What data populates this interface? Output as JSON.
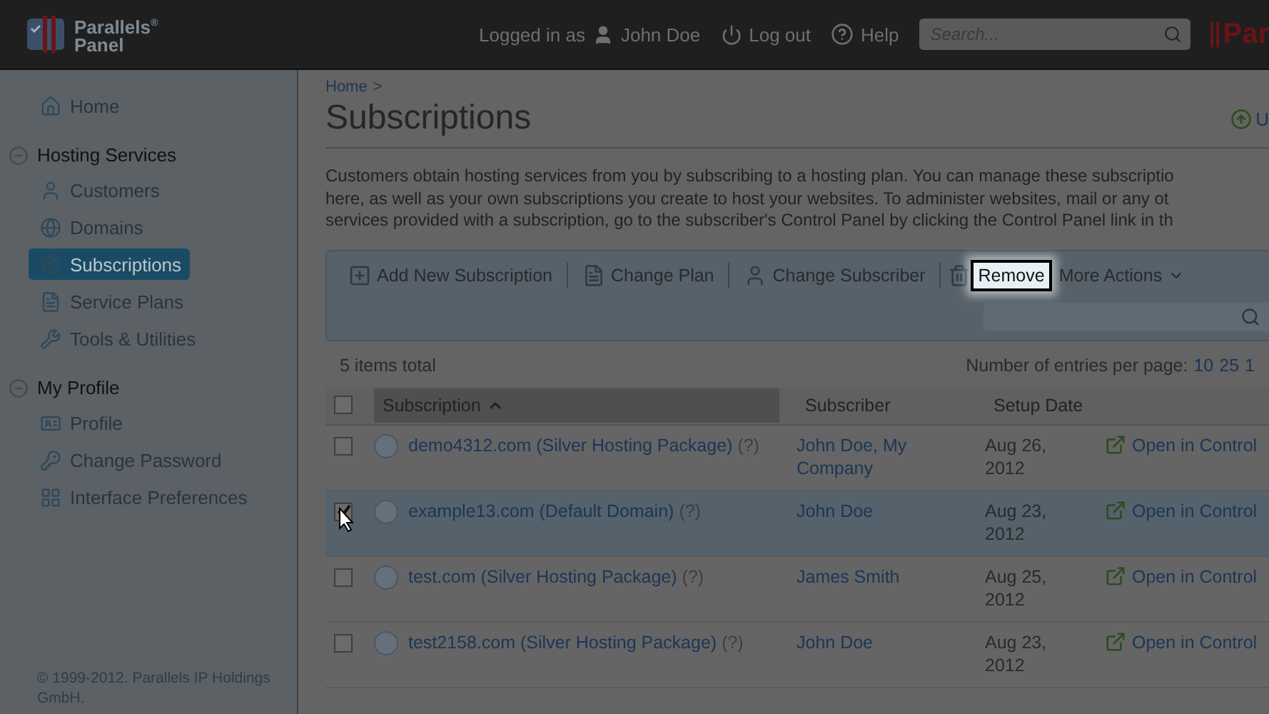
{
  "header": {
    "logo_line1": "Parallels",
    "logo_mark": "®",
    "logo_line2": "Panel",
    "logged_in_label": "Logged in as",
    "user": "John Doe",
    "logout": "Log out",
    "help": "Help",
    "search": {
      "placeholder": "Search..."
    },
    "brand_fragment": "Par"
  },
  "sidebar": {
    "items": [
      {
        "kind": "link",
        "label": "Home",
        "selected": false
      },
      {
        "kind": "section",
        "label": "Hosting Services",
        "expanded": true,
        "children": [
          {
            "label": "Customers",
            "selected": false
          },
          {
            "label": "Domains",
            "selected": false
          },
          {
            "label": "Subscriptions",
            "selected": true
          },
          {
            "label": "Service Plans",
            "selected": false
          },
          {
            "label": "Tools & Utilities",
            "selected": false
          }
        ]
      },
      {
        "kind": "section",
        "label": "My Profile",
        "expanded": true,
        "children": [
          {
            "label": "Profile",
            "selected": false
          },
          {
            "label": "Change Password",
            "selected": false
          },
          {
            "label": "Interface Preferences",
            "selected": false
          }
        ]
      }
    ],
    "footer": "© 1999-2012. Parallels IP Holdings GmbH."
  },
  "breadcrumb": {
    "items": [
      "Home"
    ],
    "separator": ">"
  },
  "title": "Subscriptions",
  "title_action": "U",
  "description": [
    "Customers obtain hosting services from you by subscribing to a hosting plan. You can manage these subscriptio",
    "here, as well as your own subscriptions you create to host your websites. To administer websites, mail or any ot",
    "services provided with a subscription, go to the subscriber's Control Panel by clicking the Control Panel link in th"
  ],
  "toolbar": [
    {
      "kind": "button",
      "label": "Add New Subscription",
      "highlighted": false
    },
    {
      "kind": "button",
      "label": "Change Plan",
      "highlighted": false
    },
    {
      "kind": "button",
      "label": "Change Subscriber",
      "highlighted": false
    },
    {
      "kind": "button",
      "label": "Remove",
      "highlighted": true
    },
    {
      "kind": "menu",
      "label": "More Actions",
      "highlighted": false
    }
  ],
  "items_total": "5 items total",
  "per_page_label": "Number of entries per page:",
  "per_page_options": [
    "10",
    "25",
    "1"
  ],
  "table": {
    "columns": [
      {
        "label": "Subscription",
        "sorted": true
      },
      {
        "label": "Subscriber",
        "sorted": false
      },
      {
        "label": "Setup Date",
        "sorted": false
      }
    ],
    "select_all": false,
    "rows": [
      {
        "subscription": "demo4312.com (Silver Hosting Package)",
        "hint": "(?)",
        "subscriber": "John Doe, My Company",
        "date": "Aug 26, 2012",
        "action": "Open in Control",
        "checked": false
      },
      {
        "subscription": "example13.com (Default Domain)",
        "hint": "(?)",
        "subscriber": "John Doe",
        "date": "Aug 23, 2012",
        "action": "Open in Control",
        "checked": true
      },
      {
        "subscription": "test.com (Silver Hosting Package)",
        "hint": "(?)",
        "subscriber": "James Smith",
        "date": "Aug 25, 2012",
        "action": "Open in Control",
        "checked": false
      },
      {
        "subscription": "test2158.com (Silver Hosting Package)",
        "hint": "(?)",
        "subscriber": "John Doe",
        "date": "Aug 23, 2012",
        "action": "Open in Control",
        "checked": false
      }
    ]
  }
}
